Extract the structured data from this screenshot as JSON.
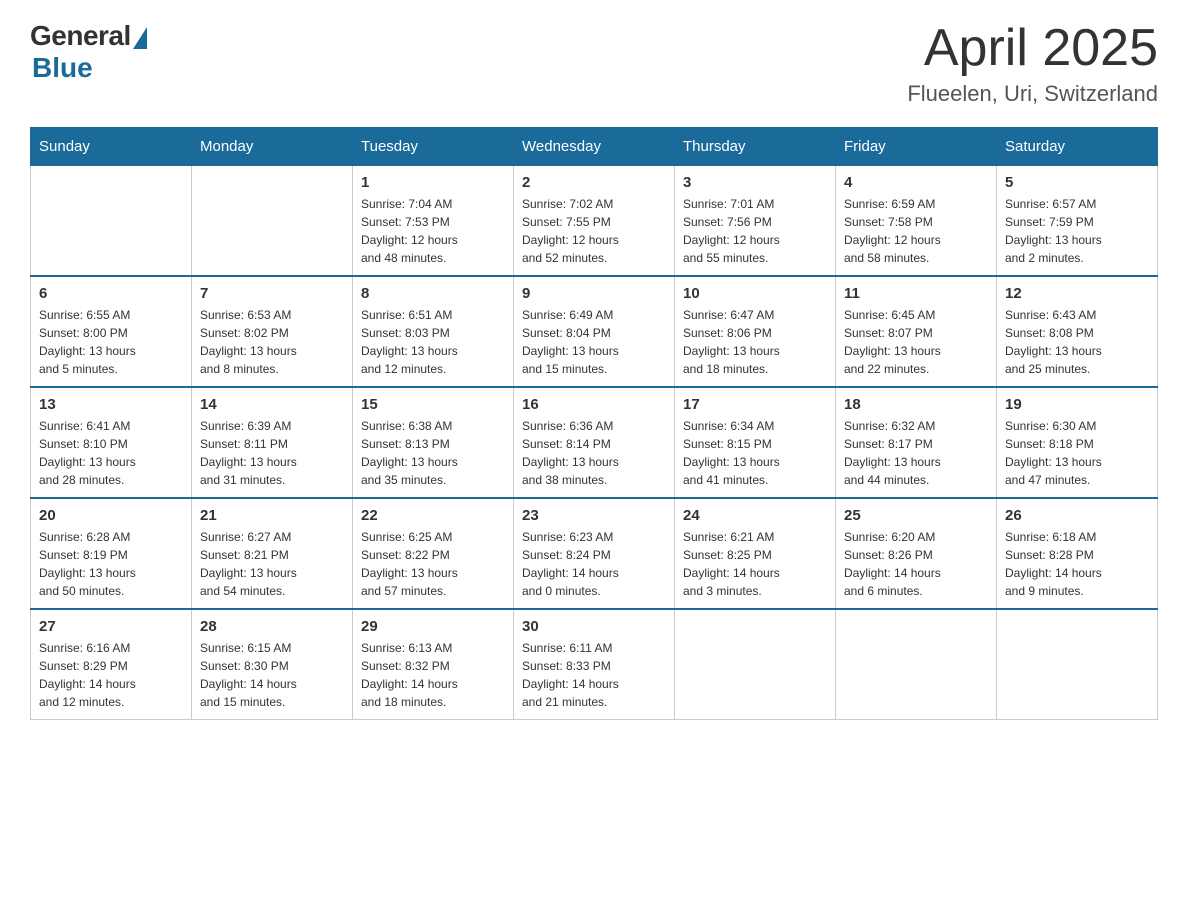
{
  "header": {
    "logo_general": "General",
    "logo_blue": "Blue",
    "month_year": "April 2025",
    "location": "Flueelen, Uri, Switzerland"
  },
  "days_of_week": [
    "Sunday",
    "Monday",
    "Tuesday",
    "Wednesday",
    "Thursday",
    "Friday",
    "Saturday"
  ],
  "weeks": [
    [
      {
        "day": "",
        "info": ""
      },
      {
        "day": "",
        "info": ""
      },
      {
        "day": "1",
        "info": "Sunrise: 7:04 AM\nSunset: 7:53 PM\nDaylight: 12 hours\nand 48 minutes."
      },
      {
        "day": "2",
        "info": "Sunrise: 7:02 AM\nSunset: 7:55 PM\nDaylight: 12 hours\nand 52 minutes."
      },
      {
        "day": "3",
        "info": "Sunrise: 7:01 AM\nSunset: 7:56 PM\nDaylight: 12 hours\nand 55 minutes."
      },
      {
        "day": "4",
        "info": "Sunrise: 6:59 AM\nSunset: 7:58 PM\nDaylight: 12 hours\nand 58 minutes."
      },
      {
        "day": "5",
        "info": "Sunrise: 6:57 AM\nSunset: 7:59 PM\nDaylight: 13 hours\nand 2 minutes."
      }
    ],
    [
      {
        "day": "6",
        "info": "Sunrise: 6:55 AM\nSunset: 8:00 PM\nDaylight: 13 hours\nand 5 minutes."
      },
      {
        "day": "7",
        "info": "Sunrise: 6:53 AM\nSunset: 8:02 PM\nDaylight: 13 hours\nand 8 minutes."
      },
      {
        "day": "8",
        "info": "Sunrise: 6:51 AM\nSunset: 8:03 PM\nDaylight: 13 hours\nand 12 minutes."
      },
      {
        "day": "9",
        "info": "Sunrise: 6:49 AM\nSunset: 8:04 PM\nDaylight: 13 hours\nand 15 minutes."
      },
      {
        "day": "10",
        "info": "Sunrise: 6:47 AM\nSunset: 8:06 PM\nDaylight: 13 hours\nand 18 minutes."
      },
      {
        "day": "11",
        "info": "Sunrise: 6:45 AM\nSunset: 8:07 PM\nDaylight: 13 hours\nand 22 minutes."
      },
      {
        "day": "12",
        "info": "Sunrise: 6:43 AM\nSunset: 8:08 PM\nDaylight: 13 hours\nand 25 minutes."
      }
    ],
    [
      {
        "day": "13",
        "info": "Sunrise: 6:41 AM\nSunset: 8:10 PM\nDaylight: 13 hours\nand 28 minutes."
      },
      {
        "day": "14",
        "info": "Sunrise: 6:39 AM\nSunset: 8:11 PM\nDaylight: 13 hours\nand 31 minutes."
      },
      {
        "day": "15",
        "info": "Sunrise: 6:38 AM\nSunset: 8:13 PM\nDaylight: 13 hours\nand 35 minutes."
      },
      {
        "day": "16",
        "info": "Sunrise: 6:36 AM\nSunset: 8:14 PM\nDaylight: 13 hours\nand 38 minutes."
      },
      {
        "day": "17",
        "info": "Sunrise: 6:34 AM\nSunset: 8:15 PM\nDaylight: 13 hours\nand 41 minutes."
      },
      {
        "day": "18",
        "info": "Sunrise: 6:32 AM\nSunset: 8:17 PM\nDaylight: 13 hours\nand 44 minutes."
      },
      {
        "day": "19",
        "info": "Sunrise: 6:30 AM\nSunset: 8:18 PM\nDaylight: 13 hours\nand 47 minutes."
      }
    ],
    [
      {
        "day": "20",
        "info": "Sunrise: 6:28 AM\nSunset: 8:19 PM\nDaylight: 13 hours\nand 50 minutes."
      },
      {
        "day": "21",
        "info": "Sunrise: 6:27 AM\nSunset: 8:21 PM\nDaylight: 13 hours\nand 54 minutes."
      },
      {
        "day": "22",
        "info": "Sunrise: 6:25 AM\nSunset: 8:22 PM\nDaylight: 13 hours\nand 57 minutes."
      },
      {
        "day": "23",
        "info": "Sunrise: 6:23 AM\nSunset: 8:24 PM\nDaylight: 14 hours\nand 0 minutes."
      },
      {
        "day": "24",
        "info": "Sunrise: 6:21 AM\nSunset: 8:25 PM\nDaylight: 14 hours\nand 3 minutes."
      },
      {
        "day": "25",
        "info": "Sunrise: 6:20 AM\nSunset: 8:26 PM\nDaylight: 14 hours\nand 6 minutes."
      },
      {
        "day": "26",
        "info": "Sunrise: 6:18 AM\nSunset: 8:28 PM\nDaylight: 14 hours\nand 9 minutes."
      }
    ],
    [
      {
        "day": "27",
        "info": "Sunrise: 6:16 AM\nSunset: 8:29 PM\nDaylight: 14 hours\nand 12 minutes."
      },
      {
        "day": "28",
        "info": "Sunrise: 6:15 AM\nSunset: 8:30 PM\nDaylight: 14 hours\nand 15 minutes."
      },
      {
        "day": "29",
        "info": "Sunrise: 6:13 AM\nSunset: 8:32 PM\nDaylight: 14 hours\nand 18 minutes."
      },
      {
        "day": "30",
        "info": "Sunrise: 6:11 AM\nSunset: 8:33 PM\nDaylight: 14 hours\nand 21 minutes."
      },
      {
        "day": "",
        "info": ""
      },
      {
        "day": "",
        "info": ""
      },
      {
        "day": "",
        "info": ""
      }
    ]
  ]
}
